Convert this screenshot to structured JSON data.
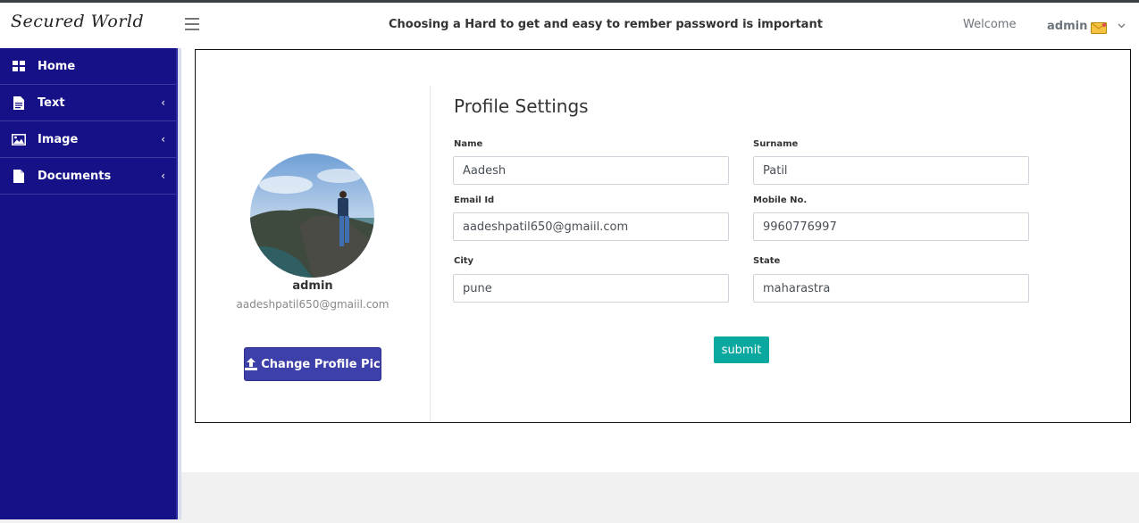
{
  "header": {
    "logo_text": "Secured World",
    "notice": "Choosing a Hard to get and easy to rember password is important",
    "welcome": "Welcome",
    "user_name": "admin"
  },
  "sidebar": {
    "items": [
      {
        "label": "Home",
        "icon": "grid-icon"
      },
      {
        "label": "Text",
        "icon": "file-text-icon",
        "chevron": "‹"
      },
      {
        "label": "Image",
        "icon": "image-icon",
        "chevron": "‹"
      },
      {
        "label": "Documents",
        "icon": "file-icon",
        "chevron": "‹"
      }
    ]
  },
  "profile": {
    "name": "admin",
    "email": "aadeshpatil650@gmaiil.com",
    "change_pic_label": "Change Profile Pic"
  },
  "settings": {
    "title": "Profile Settings",
    "fields": {
      "name": {
        "label": "Name",
        "value": "Aadesh"
      },
      "surname": {
        "label": "Surname",
        "value": "Patil"
      },
      "email": {
        "label": "Email Id",
        "value": "aadeshpatil650@gmaiil.com"
      },
      "mobile": {
        "label": "Mobile No.",
        "value": "9960776997"
      },
      "city": {
        "label": "City",
        "value": "pune"
      },
      "state": {
        "label": "State",
        "value": "maharastra"
      }
    },
    "submit_label": "submit"
  },
  "colors": {
    "sidebar": "#161187",
    "primary_button": "#3c40a8",
    "submit_button": "#0aa89e"
  }
}
